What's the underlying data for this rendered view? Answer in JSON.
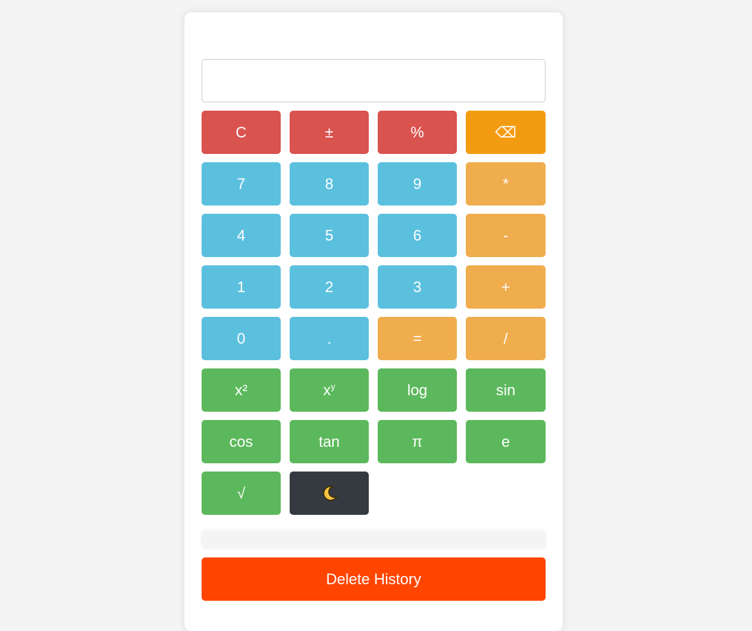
{
  "display": {
    "value": "",
    "placeholder": ""
  },
  "buttons": [
    {
      "label": "C",
      "name": "clear-button",
      "color": "red"
    },
    {
      "label": "±",
      "name": "toggle-sign-button",
      "color": "red"
    },
    {
      "label": "%",
      "name": "percent-button",
      "color": "red"
    },
    {
      "label": "⌫",
      "name": "backspace-button",
      "color": "orange-dark"
    },
    {
      "label": "7",
      "name": "digit-7-button",
      "color": "blue"
    },
    {
      "label": "8",
      "name": "digit-8-button",
      "color": "blue"
    },
    {
      "label": "9",
      "name": "digit-9-button",
      "color": "blue"
    },
    {
      "label": "*",
      "name": "multiply-button",
      "color": "orange"
    },
    {
      "label": "4",
      "name": "digit-4-button",
      "color": "blue"
    },
    {
      "label": "5",
      "name": "digit-5-button",
      "color": "blue"
    },
    {
      "label": "6",
      "name": "digit-6-button",
      "color": "blue"
    },
    {
      "label": "-",
      "name": "subtract-button",
      "color": "orange"
    },
    {
      "label": "1",
      "name": "digit-1-button",
      "color": "blue"
    },
    {
      "label": "2",
      "name": "digit-2-button",
      "color": "blue"
    },
    {
      "label": "3",
      "name": "digit-3-button",
      "color": "blue"
    },
    {
      "label": "+",
      "name": "add-button",
      "color": "orange"
    },
    {
      "label": "0",
      "name": "digit-0-button",
      "color": "blue"
    },
    {
      "label": ".",
      "name": "decimal-button",
      "color": "blue"
    },
    {
      "label": "=",
      "name": "equals-button",
      "color": "orange"
    },
    {
      "label": "/",
      "name": "divide-button",
      "color": "orange"
    },
    {
      "label": "x²",
      "name": "square-button",
      "color": "green"
    },
    {
      "label": "x",
      "sup": "y",
      "name": "power-button",
      "color": "green"
    },
    {
      "label": "log",
      "name": "log-button",
      "color": "green"
    },
    {
      "label": "sin",
      "name": "sin-button",
      "color": "green"
    },
    {
      "label": "cos",
      "name": "cos-button",
      "color": "green"
    },
    {
      "label": "tan",
      "name": "tan-button",
      "color": "green"
    },
    {
      "label": "π",
      "name": "pi-button",
      "color": "green"
    },
    {
      "label": "e",
      "name": "e-button",
      "color": "green"
    },
    {
      "label": "√",
      "name": "sqrt-button",
      "color": "green"
    },
    {
      "label": "",
      "icon": "moon-icon",
      "name": "dark-mode-toggle-button",
      "color": "dark"
    }
  ],
  "history": {
    "entries": []
  },
  "delete_history_label": "Delete History",
  "colors": {
    "red": "#d9534f",
    "blue": "#5bc0de",
    "orange": "#f0ad4e",
    "orange_dark": "#f39c12",
    "green": "#5cb85c",
    "dark": "#343a40",
    "delete": "#ff4500"
  }
}
